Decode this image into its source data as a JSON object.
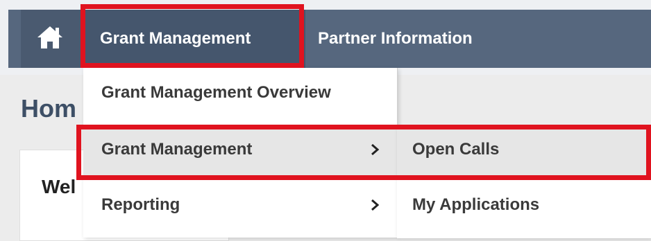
{
  "nav": {
    "home_icon": "home-icon",
    "grant_management": "Grant Management",
    "partner_information": "Partner Information"
  },
  "page": {
    "title_visible": "Hom",
    "welcome_visible": "Wel"
  },
  "dropdown": {
    "items": [
      {
        "label": "Grant Management Overview"
      },
      {
        "label": "Grant Management",
        "has_submenu": true,
        "chevron_icon": "chevron-right-icon"
      },
      {
        "label": "Reporting",
        "has_submenu": true,
        "chevron_icon": "chevron-right-icon"
      }
    ]
  },
  "submenu": {
    "items": [
      {
        "label": "Open Calls"
      },
      {
        "label": "My Applications"
      }
    ]
  },
  "colors": {
    "navbar": "#56677e",
    "highlight": "#e0131f",
    "hover_row": "#e6e6e6"
  }
}
